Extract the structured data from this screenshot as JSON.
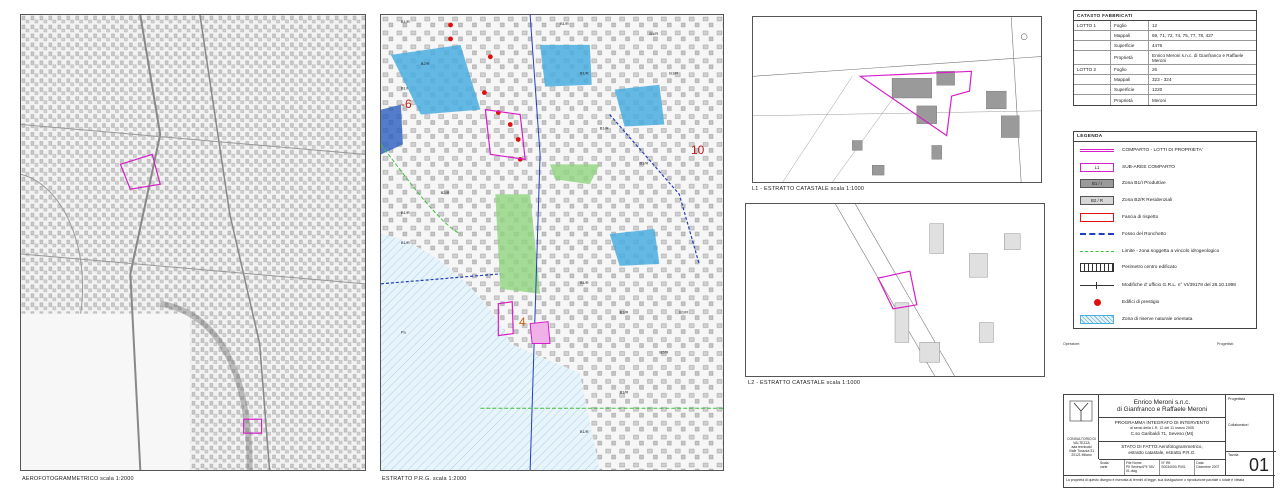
{
  "panels": {
    "aerial_caption": "AEROFOTOGRAMMETRICO    scala 1:2000",
    "prg_caption": "ESTRATTO P.R.G.   scala 1:2000",
    "l1_caption": "L1 - ESTRATTO CATASTALE   scala 1:1000",
    "l2_caption": "L2 - ESTRATTO CATASTALE   scala 1:1000"
  },
  "prg_labels": {
    "minus6": "-6",
    "ten": "10",
    "four": "4"
  },
  "catasto": {
    "title": "CATASTO FABBRICATI",
    "rows": [
      {
        "lot": "LOTTO 1",
        "key": "Foglio",
        "value": "12"
      },
      {
        "lot": "",
        "key": "Mappali",
        "value": "69, 71, 72, 74, 75, 77, 78, 427"
      },
      {
        "lot": "",
        "key": "Superficie",
        "value": "4476"
      },
      {
        "lot": "",
        "key": "Proprietà",
        "value": "Enrico Meroni s.n.c. di Gianfranco e Raffaele Meroni"
      },
      {
        "lot": "LOTTO 2",
        "key": "Foglio",
        "value": "26"
      },
      {
        "lot": "",
        "key": "Mappali",
        "value": "323 - 324"
      },
      {
        "lot": "",
        "key": "Superficie",
        "value": "1220"
      },
      {
        "lot": "",
        "key": "Proprietà",
        "value": "Meroni"
      }
    ]
  },
  "legend": {
    "title": "LEGENDA",
    "items": [
      {
        "label": "COMPARTO - LOTTI DI PROPRIETA'",
        "symbol": "comparto-line"
      },
      {
        "label": "SUB-AREE  COMPARTO",
        "symbol": "subarea-box",
        "sym_text": "L1"
      },
      {
        "label": "Zona B1/I Produttive",
        "symbol": "zone-b1",
        "sym_text": "B1 / I"
      },
      {
        "label": "Zona B2/R Residenziali",
        "symbol": "zone-b2",
        "sym_text": "B2 / R"
      },
      {
        "label": "Fascia di rispetto",
        "symbol": "rispetto-box"
      },
      {
        "label": "Fosso del Ronchetto",
        "symbol": "fosso-dashed"
      },
      {
        "label": "Limite - zona soggetta a vincolo idrogeologico",
        "symbol": "limite-green"
      },
      {
        "label": "Perimetro centro edificato",
        "symbol": "perimetro-box"
      },
      {
        "label": "Modifiche d' ufficio G.R.L. n° VI/39178 del 26.10.1998",
        "symbol": "modifiche-line"
      },
      {
        "label": "Edifici di prestigio",
        "symbol": "red-dot"
      },
      {
        "label": "Zona di riserve naturale orientata",
        "symbol": "riserva-hatch"
      }
    ],
    "colors": {
      "magenta": "#d61fc8",
      "blue": "#1f3fbf",
      "green": "#3fbf3f",
      "red": "#e01010",
      "water": "#4aaee0"
    }
  },
  "side_labels": {
    "operatore": "Operatore:",
    "progettisti": "Progettisti:"
  },
  "title_block": {
    "owner_line1": "Enrico Meroni s.n.c.",
    "owner_line2": "di Gianfranco e Raffaele Meroni",
    "program": "PROGRAMMA INTEGRATO DI INTERVENTO",
    "program_sub": "ai sensi della L.R. 12 del 11 marzo 2005",
    "address": "C.so Garibaldi 71, Seveso (MI)",
    "stato1": "STATO DI FATTO:Aerofotogrammetrico,",
    "stato2": "estratto catastale, estratto P.R.G.",
    "right_top": "Progettista",
    "right_mid": "Collaboratori",
    "right_tav": "Tavola",
    "sheet_number": "01",
    "scale_label": "Scala",
    "scale_val": "varie",
    "file_label": "File Nome",
    "file_val": "PII Seveso\\PII TAV 01.dwg",
    "num_label": "N° Rif.",
    "num_val": "S0034000-PII01",
    "date_label": "Data",
    "date_val": "Dicembre 2007",
    "footer": "La proprietà di questo disegno è riservata ai termini di legge, sua divulgazione o riproduzione parziale o totale è vietata",
    "studio_line1": "CONSULTORIO DI VALTEZZA",
    "studio_line2": "aaa tecnicaid",
    "studio_line3": "Viale Turazza 31",
    "studio_line4": "20121 Milano"
  }
}
